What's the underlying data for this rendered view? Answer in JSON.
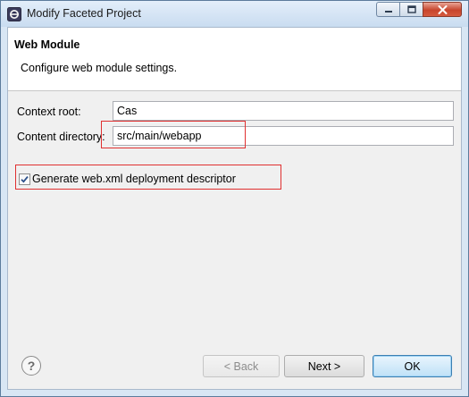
{
  "window": {
    "title": "Modify Faceted Project"
  },
  "header": {
    "title": "Web Module",
    "description": "Configure web module settings."
  },
  "form": {
    "context_root": {
      "label": "Context root:",
      "value": "Cas"
    },
    "content_directory": {
      "label": "Content directory:",
      "value": "src/main/webapp"
    },
    "generate_descriptor": {
      "label": "Generate web.xml deployment descriptor",
      "checked": true
    }
  },
  "buttons": {
    "help": "?",
    "back": "< Back",
    "next": "Next >",
    "ok": "OK"
  },
  "colors": {
    "highlight": "#e03030",
    "title_bar": "#d8e6f4",
    "close_button": "#c7452d"
  }
}
